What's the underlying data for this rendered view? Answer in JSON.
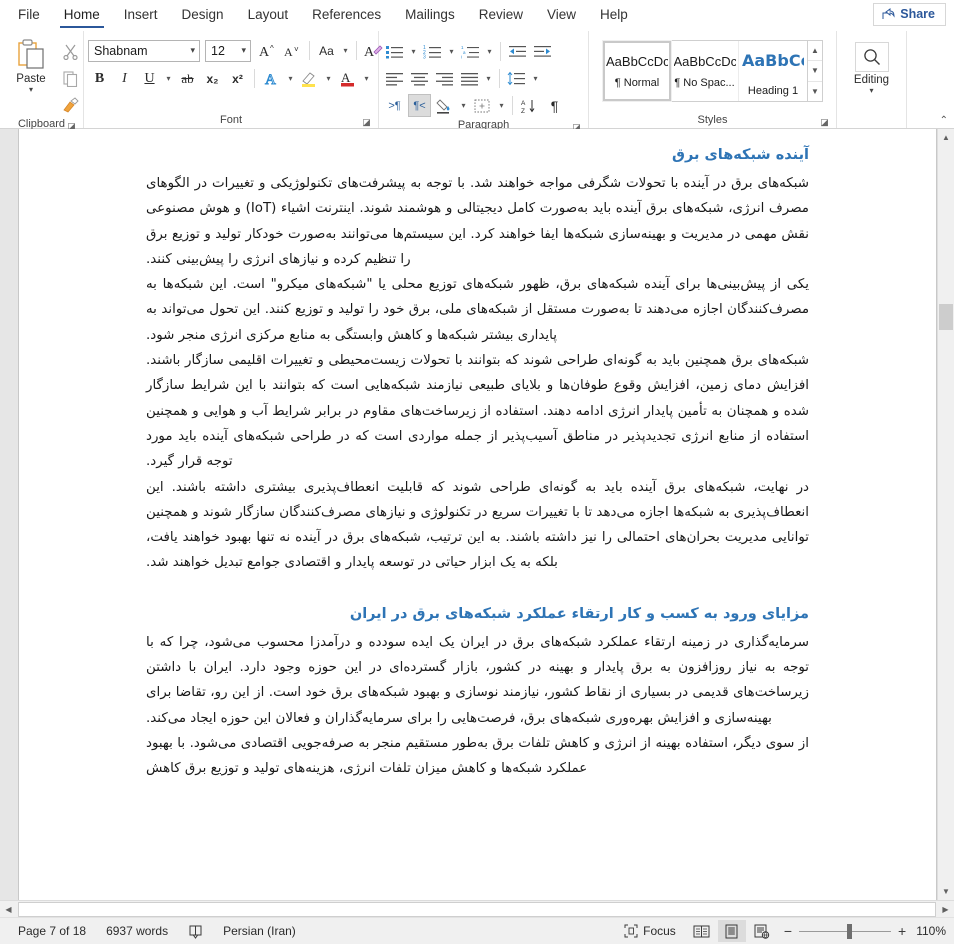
{
  "titlebar": {
    "share_label": "Share",
    "share_icon": "share-icon"
  },
  "ribbon": {
    "tabs": [
      {
        "label": "File",
        "name": "tab-file"
      },
      {
        "label": "Home",
        "name": "tab-home",
        "active": true
      },
      {
        "label": "Insert",
        "name": "tab-insert"
      },
      {
        "label": "Design",
        "name": "tab-design"
      },
      {
        "label": "Layout",
        "name": "tab-layout"
      },
      {
        "label": "References",
        "name": "tab-references"
      },
      {
        "label": "Mailings",
        "name": "tab-mailings"
      },
      {
        "label": "Review",
        "name": "tab-review"
      },
      {
        "label": "View",
        "name": "tab-view"
      },
      {
        "label": "Help",
        "name": "tab-help"
      }
    ],
    "clipboard": {
      "group_label": "Clipboard",
      "paste_label": "Paste",
      "cut_icon": "scissors-icon",
      "copy_icon": "copy-icon",
      "format_painter_icon": "format-painter-icon"
    },
    "font": {
      "group_label": "Font",
      "font_name": "Shabnam",
      "font_size": "12",
      "grow_font": "A^",
      "shrink_font": "Aˇ",
      "change_case": "Aa",
      "clear_formatting": "clear-formatting-icon",
      "bold": "B",
      "italic": "I",
      "underline": "U",
      "strikethrough": "ab",
      "subscript": "x₂",
      "superscript": "x²",
      "text_effects": "A",
      "highlight": "highlight-icon",
      "font_color": "A"
    },
    "paragraph": {
      "group_label": "Paragraph",
      "bullets": "bullets-icon",
      "numbering": "numbering-icon",
      "multilevel": "multilevel-list-icon",
      "decrease_indent": "decrease-indent-icon",
      "increase_indent": "increase-indent-icon",
      "align_left": "align-left-icon",
      "align_center": "align-center-icon",
      "align_right": "align-right-icon",
      "justify": "justify-icon",
      "line_spacing": "line-spacing-icon",
      "ltr_text": "ltr-icon",
      "rtl_text": "rtl-icon",
      "rtl_active": true,
      "shading": "shading-icon",
      "borders": "borders-icon",
      "sort": "sort-icon",
      "show_marks": "¶"
    },
    "styles": {
      "group_label": "Styles",
      "items": [
        {
          "preview": "AaBbCcDc",
          "name": "¶ Normal",
          "selected": true,
          "heading": false
        },
        {
          "preview": "AaBbCcDc",
          "name": "¶ No Spac...",
          "selected": false,
          "heading": false
        },
        {
          "preview": "AaBbCс",
          "name": "Heading 1",
          "selected": false,
          "heading": true
        }
      ]
    },
    "editing": {
      "group_label": "Editing",
      "label": "Editing",
      "icon": "search-icon"
    },
    "collapse_icon": "chevron-up-icon"
  },
  "document": {
    "blocks": [
      {
        "type": "h1",
        "text": "آینده شبکه‌های برق"
      },
      {
        "type": "p",
        "text": "شبکه‌های برق در آینده با تحولات شگرفی مواجه خواهند شد. با توجه به پیشرفت‌های تکنولوژیکی و تغییرات در الگوهای مصرف انرژی، شبکه‌های برق آینده باید به‌صورت کامل دیجیتالی و هوشمند شوند. اینترنت اشیاء (IoT) و هوش مصنوعی نقش مهمی در مدیریت و بهینه‌سازی شبکه‌ها ایفا خواهند کرد. این سیستم‌ها می‌توانند به‌صورت خودکار تولید و توزیع برق را تنظیم کرده و نیازهای انرژی را پیش‌بینی کنند."
      },
      {
        "type": "p",
        "text": "یکی از پیش‌بینی‌ها برای آینده شبکه‌های برق، ظهور شبکه‌های توزیع محلی یا \"شبکه‌های میکرو\" است. این شبکه‌ها به مصرف‌کنندگان اجازه می‌دهند تا به‌صورت مستقل از شبکه‌های ملی، برق خود را تولید و توزیع کنند. این تحول می‌تواند به پایداری بیشتر شبکه‌ها و کاهش وابستگی به منابع مرکزی انرژی منجر شود."
      },
      {
        "type": "p",
        "text": "شبکه‌های برق همچنین باید به گونه‌ای طراحی شوند که بتوانند با تحولات زیست‌محیطی و تغییرات اقلیمی سازگار باشند. افزایش دمای زمین، افزایش وقوع طوفان‌ها و بلایای طبیعی نیازمند شبکه‌هایی است که بتوانند با این شرایط سازگار شده و همچنان به تأمین پایدار انرژی ادامه دهند. استفاده از زیرساخت‌های مقاوم در برابر شرایط آب و هوایی و همچنین استفاده از منابع انرژی تجدیدپذیر در مناطق آسیب‌پذیر از جمله مواردی است که در طراحی شبکه‌های آینده باید مورد توجه قرار گیرد."
      },
      {
        "type": "p",
        "text": "در نهایت، شبکه‌های برق آینده باید به گونه‌ای طراحی شوند که قابلیت انعطاف‌پذیری بیشتری داشته باشند. این انعطاف‌پذیری به شبکه‌ها اجازه می‌دهد تا با تغییرات سریع در تکنولوژی و نیازهای مصرف‌کنندگان سازگار شوند و همچنین توانایی مدیریت بحران‌های احتمالی را نیز داشته باشند. به این ترتیب، شبکه‌های برق در آینده نه تنها بهبود خواهند یافت، بلکه به یک ابزار حیاتی در توسعه پایدار و اقتصادی جوامع تبدیل خواهند شد."
      },
      {
        "type": "h1",
        "text": "مزایای ورود به کسب و کار ارتقاء عملکرد شبکه‌های برق در ایران"
      },
      {
        "type": "p",
        "text": "سرمایه‌گذاری در زمینه ارتقاء عملکرد شبکه‌های برق در ایران یک ایده سودده و درآمدزا محسوب می‌شود، چرا که با توجه به نیاز روزافزون به برق پایدار و بهینه در کشور، بازار گسترده‌ای در این حوزه وجود دارد. ایران با داشتن زیرساخت‌های قدیمی در بسیاری از نقاط کشور، نیازمند نوسازی و بهبود شبکه‌های برق خود است. از این رو، تقاضا برای بهینه‌سازی و افزایش بهره‌وری شبکه‌های برق، فرصت‌هایی را برای سرمایه‌گذاران و فعالان این حوزه ایجاد می‌کند."
      },
      {
        "type": "p",
        "text": "از سوی دیگر، استفاده بهینه از انرژی و کاهش تلفات برق به‌طور مستقیم منجر به صرفه‌جویی اقتصادی می‌شود. با بهبود عملکرد شبکه‌ها و کاهش میزان تلفات انرژی، هزینه‌های تولید و توزیع برق کاهش"
      }
    ]
  },
  "statusbar": {
    "page_info": "Page 7 of 18",
    "word_count": "6937 words",
    "proofing_icon": "proofing-icon",
    "language": "Persian (Iran)",
    "focus_label": "Focus",
    "focus_icon": "focus-icon",
    "read_mode_icon": "read-mode-icon",
    "print_layout_icon": "print-layout-icon",
    "web_layout_icon": "web-layout-icon",
    "zoom_out": "−",
    "zoom_in": "+",
    "zoom_level": "110%"
  },
  "colors": {
    "accent": "#2b579a",
    "heading": "#2e74b5",
    "ribbon_bg": "#ffffff",
    "doc_bg": "#e6e6e6",
    "status_bg": "#f0f0f0"
  }
}
